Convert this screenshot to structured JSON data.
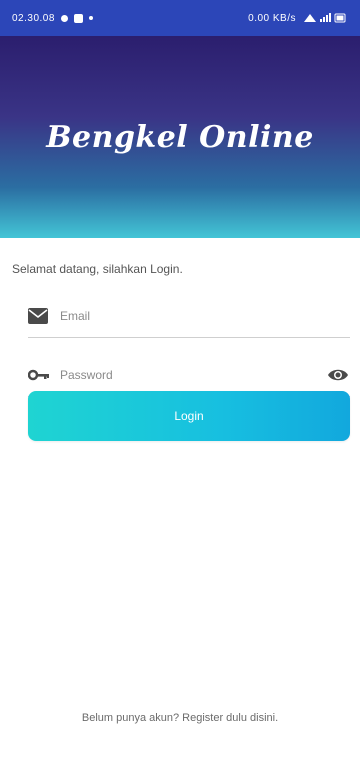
{
  "status_bar": {
    "time": "02.30.08",
    "right_text": "0.00 KB/s"
  },
  "header": {
    "title": "Bengkel Online"
  },
  "form": {
    "welcome": "Selamat datang, silahkan Login.",
    "email_placeholder": "Email",
    "password_placeholder": "Password",
    "login_label": "Login"
  },
  "footer": {
    "register_text": "Belum punya akun? Register dulu disini."
  },
  "colors": {
    "header_top": "#2b1e6e",
    "header_bottom": "#43c5d6",
    "button": "#17bfe0"
  },
  "icons": {
    "email": "envelope-icon",
    "password": "key-icon",
    "toggle": "eye-icon"
  }
}
